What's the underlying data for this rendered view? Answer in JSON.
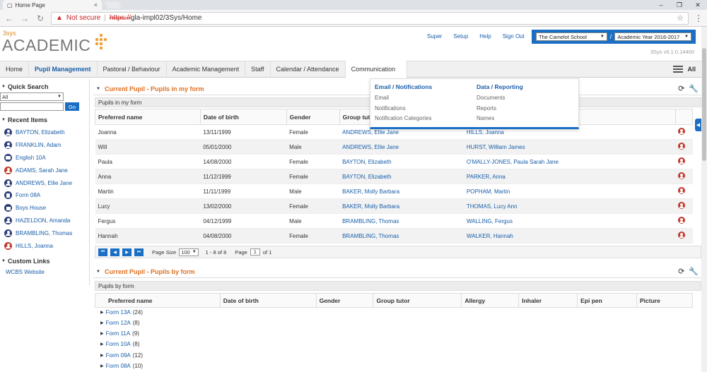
{
  "browser": {
    "tab_title": "Home Page",
    "not_secure": "Not secure",
    "url_protocol": "https://",
    "url_path": "gla-impl02/3Sys/Home"
  },
  "header": {
    "logo_small": "3sys",
    "logo_main": "ACADEMIC",
    "links": [
      "Super",
      "Setup",
      "Help",
      "Sign Out"
    ],
    "school": "The Camelot School",
    "year": "Academic Year 2016-2017",
    "version": "3Sys v5.1.0.14400"
  },
  "nav": {
    "items": [
      "Home",
      "Pupil Management",
      "Pastoral / Behaviour",
      "Academic Management",
      "Staff",
      "Calendar / Attendance",
      "Communication"
    ],
    "all_label": "All"
  },
  "sidebar": {
    "quick_search_title": "Quick Search",
    "search_scope": "All",
    "go_label": "Go",
    "recent_title": "Recent Items",
    "recent_items": [
      {
        "label": "BAYTON, Elizabeth",
        "icon": "person-icon"
      },
      {
        "label": "FRANKLIN, Adam",
        "icon": "person-icon"
      },
      {
        "label": "English 10A",
        "icon": "group-icon"
      },
      {
        "label": "ADAMS, Sarah Jane",
        "icon": "person-red-icon"
      },
      {
        "label": "ANDREWS, Ellie Jane",
        "icon": "person-icon"
      },
      {
        "label": "Form 08A",
        "icon": "book-icon"
      },
      {
        "label": "Boys House",
        "icon": "house-icon"
      },
      {
        "label": "HAZELDON, Amanda",
        "icon": "person-icon"
      },
      {
        "label": "BRAMBLING, Thomas",
        "icon": "person-icon"
      },
      {
        "label": "HILLS, Joanna",
        "icon": "person-red-icon"
      }
    ],
    "custom_links_title": "Custom Links",
    "custom_links": [
      "WCBS Website"
    ]
  },
  "panel1": {
    "title": "Current Pupil - Pupils in my form",
    "subheader": "Pupils in my form",
    "columns": [
      "Preferred name",
      "Date of birth",
      "Gender",
      "Group tutor"
    ],
    "rows": [
      {
        "name": "Joanna",
        "dob": "13/11/1999",
        "gender": "Female",
        "tutor": "ANDREWS, Ellie Jane",
        "contact": "HILLS, Joanna"
      },
      {
        "name": "Will",
        "dob": "05/01/2000",
        "gender": "Male",
        "tutor": "ANDREWS, Ellie Jane",
        "contact": "HURST, William James"
      },
      {
        "name": "Paula",
        "dob": "14/08/2000",
        "gender": "Female",
        "tutor": "BAYTON, Elizabeth",
        "contact": "O'MALLY-JONES, Paula Sarah Jane"
      },
      {
        "name": "Anna",
        "dob": "11/12/1999",
        "gender": "Female",
        "tutor": "BAYTON, Elizabeth",
        "contact": "PARKER, Anna"
      },
      {
        "name": "Martin",
        "dob": "11/11/1999",
        "gender": "Male",
        "tutor": "BAKER, Molly Barbara",
        "contact": "POPHAM, Martin"
      },
      {
        "name": "Lucy",
        "dob": "13/02/2000",
        "gender": "Female",
        "tutor": "BAKER, Molly Barbara",
        "contact": "THOMAS, Lucy Ann"
      },
      {
        "name": "Fergus",
        "dob": "04/12/1999",
        "gender": "Male",
        "tutor": "BRAMBLING, Thomas",
        "contact": "WALLING, Fergus"
      },
      {
        "name": "Hannah",
        "dob": "04/08/2000",
        "gender": "Female",
        "tutor": "BRAMBLING, Thomas",
        "contact": "WALKER, Hannah"
      }
    ],
    "pager": {
      "page_size_label": "Page Size",
      "page_size": "100",
      "range_text": "1 - 8 of 8",
      "page_label": "Page",
      "page": "1",
      "of_text": "of 1"
    }
  },
  "panel2": {
    "title": "Current Pupil - Pupils by form",
    "subheader": "Pupils by form",
    "columns": [
      "Preferred name",
      "Date of birth",
      "Gender",
      "Group tutor",
      "Allergy",
      "Inhaler",
      "Epi pen",
      "Picture"
    ],
    "forms": [
      {
        "label": "Form 13A",
        "count": "(24)"
      },
      {
        "label": "Form 12A",
        "count": "(8)"
      },
      {
        "label": "Form 11A",
        "count": "(9)"
      },
      {
        "label": "Form 10A",
        "count": "(8)"
      },
      {
        "label": "Form 09A",
        "count": "(12)"
      },
      {
        "label": "Form 08A",
        "count": "(10)"
      }
    ]
  },
  "dropdown": {
    "col1_title": "Email / Notifications",
    "col1_items": [
      "Email",
      "Notifications",
      "Notification Categories"
    ],
    "col2_title": "Data / Reporting",
    "col2_items": [
      "Documents",
      "Reports",
      "Names"
    ]
  }
}
